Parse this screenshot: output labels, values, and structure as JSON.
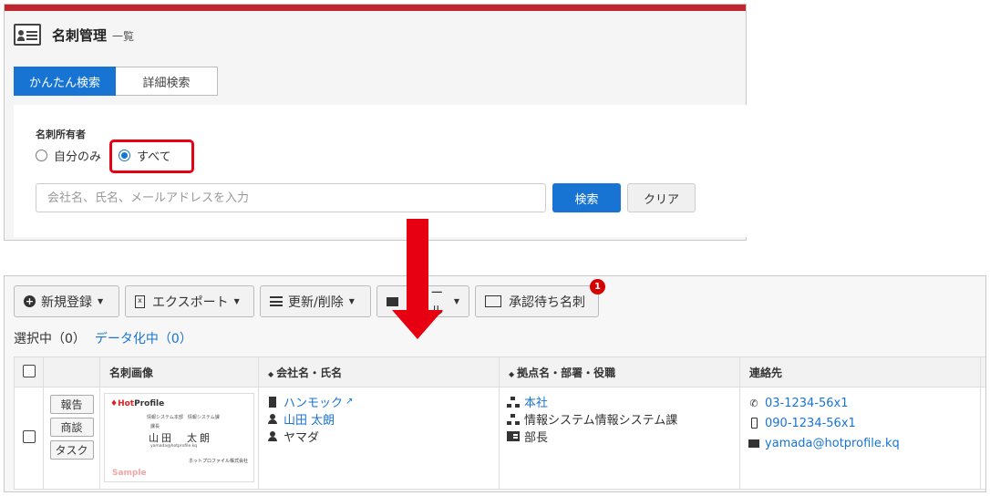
{
  "header": {
    "title": "名刺管理",
    "subtitle": "一覧"
  },
  "tabs": [
    {
      "label": "かんたん検索",
      "active": true
    },
    {
      "label": "詳細検索",
      "active": false
    }
  ],
  "search": {
    "owner_label": "名刺所有者",
    "options": [
      {
        "label": "自分のみ",
        "checked": false
      },
      {
        "label": "すべて",
        "checked": true
      }
    ],
    "placeholder": "会社名、氏名、メールアドレスを入力",
    "search_label": "検索",
    "clear_label": "クリア"
  },
  "toolbar": {
    "new_label": "新規登録",
    "export_label": "エクスポート",
    "update_label": "更新/削除",
    "mail_label": "ール",
    "pending_label": "承認待ち名刺",
    "pending_count": "1"
  },
  "selection": {
    "selected": "選択中（0）",
    "digitizing": "データ化中（0）"
  },
  "table": {
    "headers": {
      "image": "名刺画像",
      "company": "会社名・氏名",
      "branch": "拠点名・部署・役職",
      "contact": "連絡先"
    },
    "row": {
      "actions": [
        "報告",
        "商談",
        "タスク"
      ],
      "card": {
        "logo_prefix": "♦",
        "logo_red": "Hot",
        "logo_rest": "Profile",
        "dept": "情報システム本部　情報システム課",
        "title": "課長",
        "name": "山田　太朗",
        "email": "yamada@hotprofile.kq",
        "company": "ホットプロファイル株式会社",
        "sample": "Sample"
      },
      "company": "ハンモック",
      "name": "山田 太朗",
      "kana": "ヤマダ",
      "branch": "本社",
      "department": "情報システム情報システム課",
      "position": "部長",
      "phone": "03-1234-56x1",
      "mobile": "090-1234-56x1",
      "email": "yamada@hotprofile.kq"
    }
  },
  "colors": {
    "accent": "#1874d2",
    "highlight": "#e60012",
    "top_bar": "#c0262d"
  }
}
